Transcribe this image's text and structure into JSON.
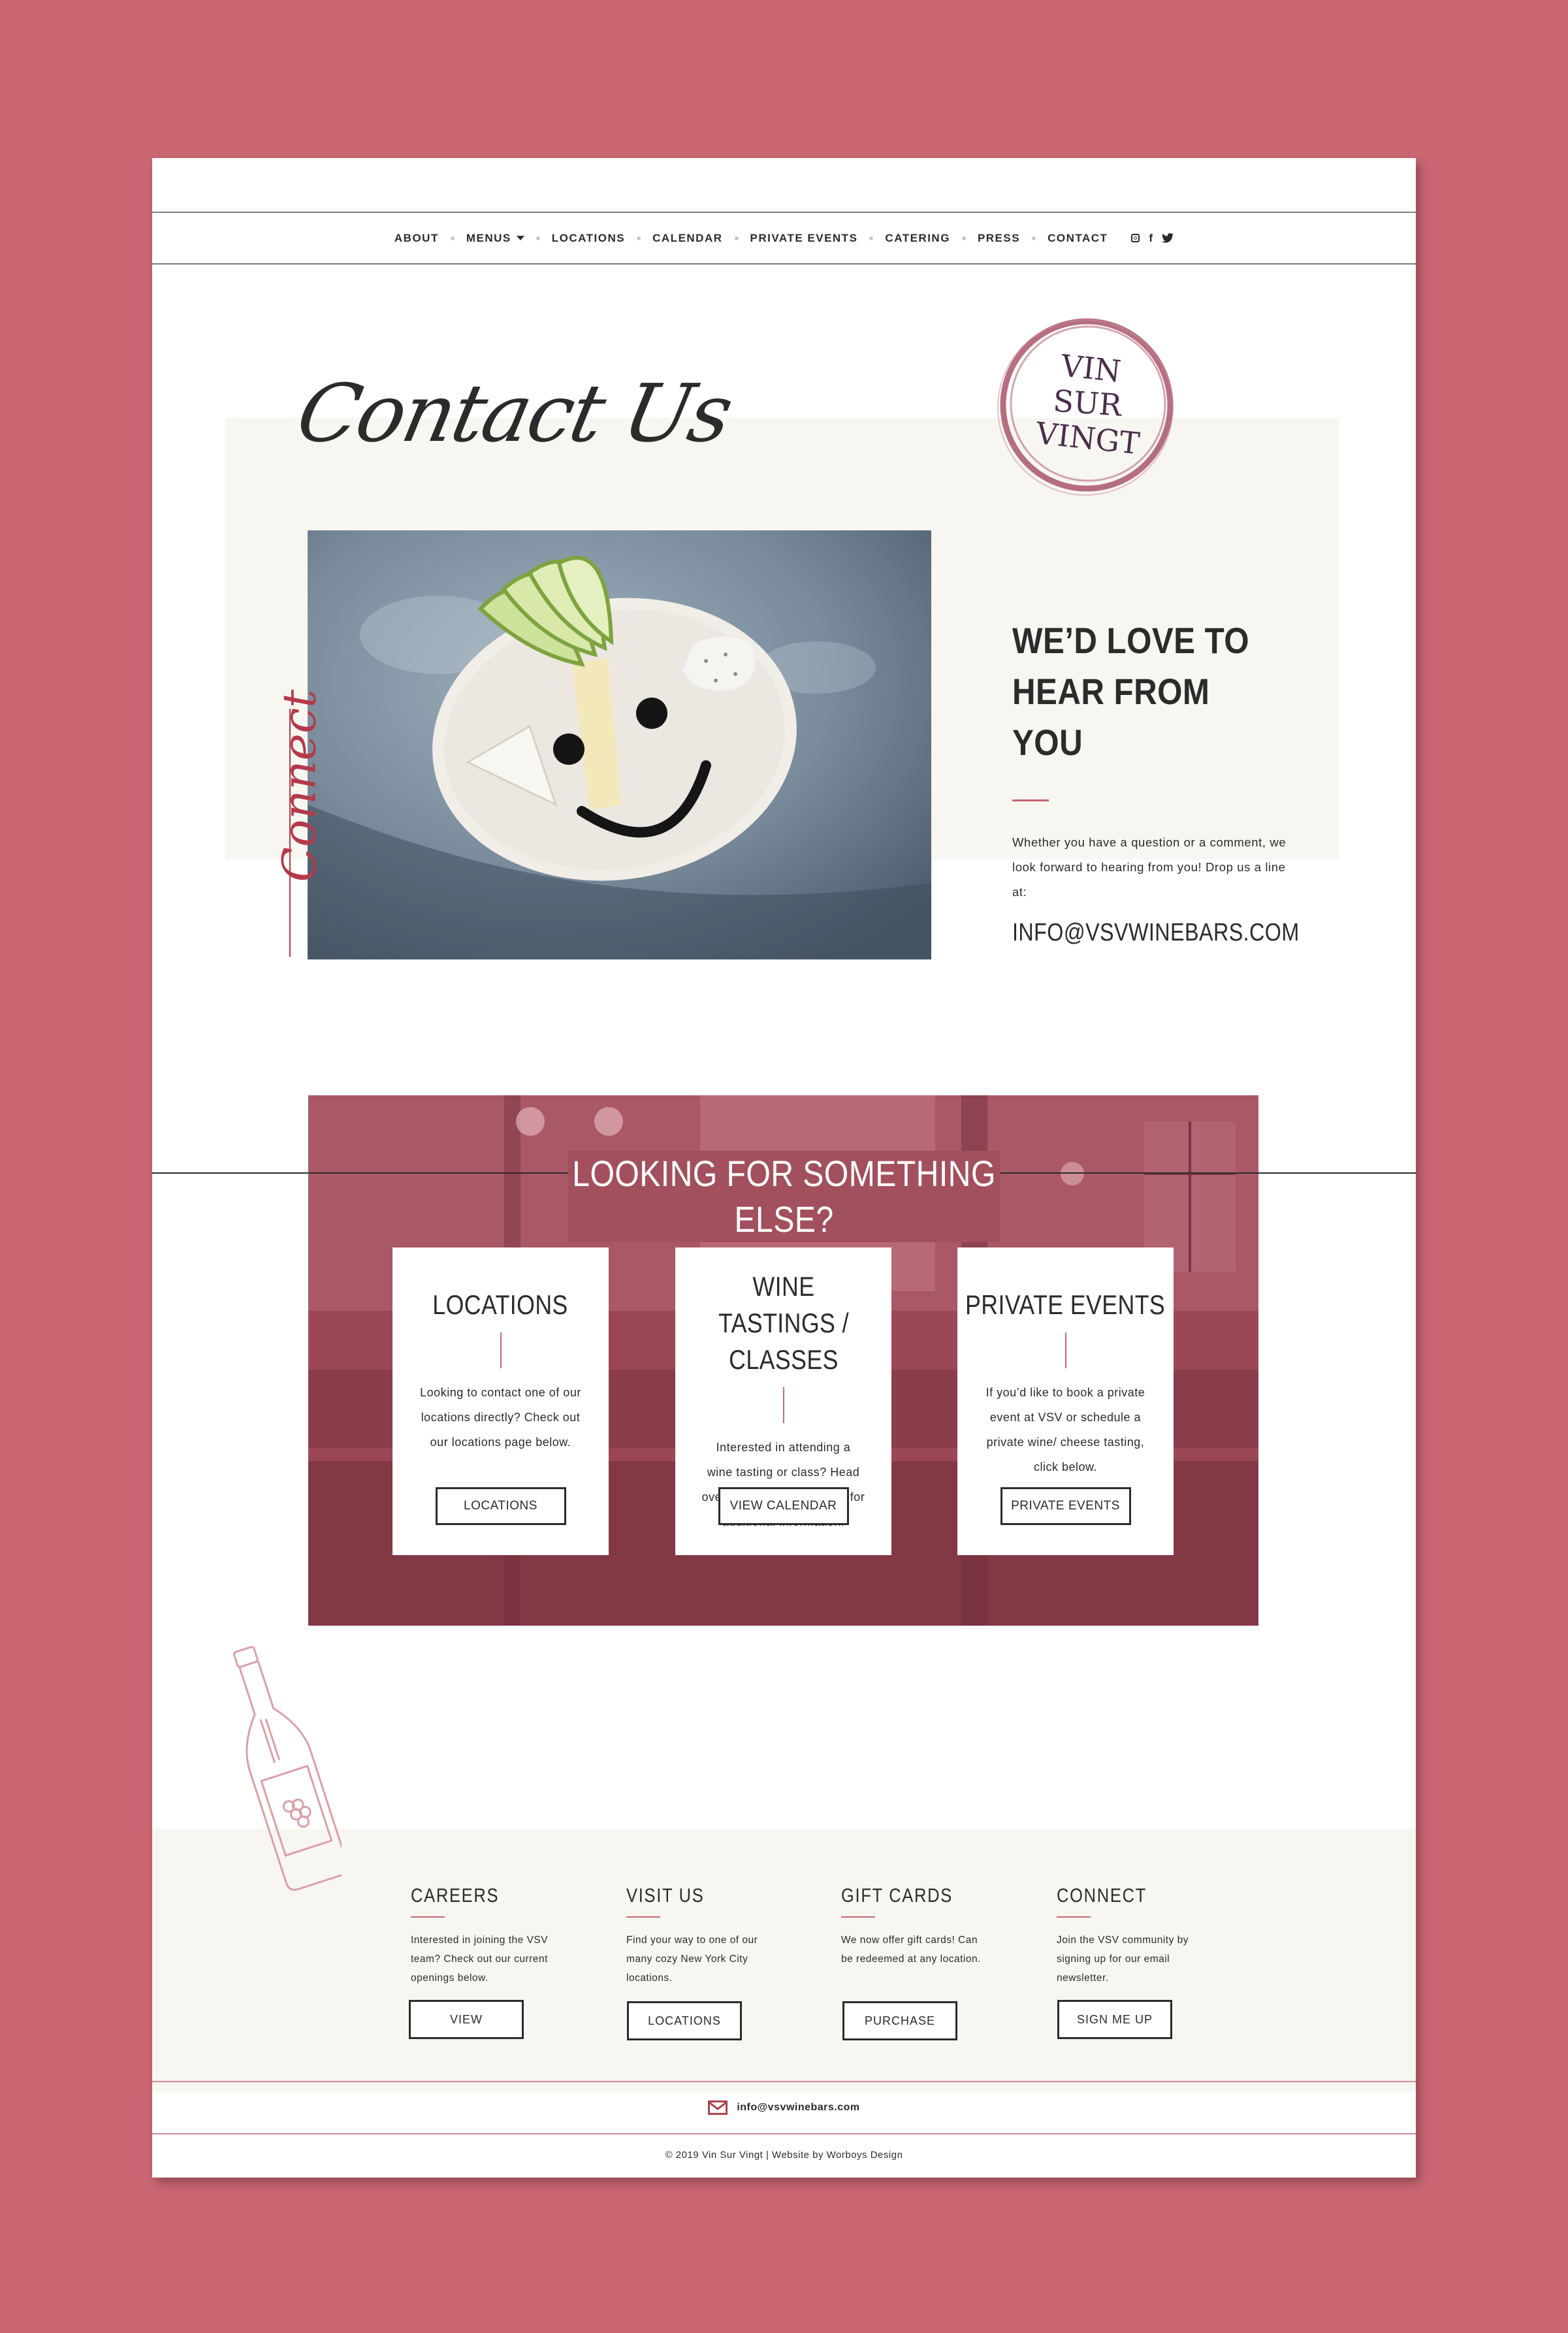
{
  "nav": {
    "items": [
      {
        "label": "ABOUT"
      },
      {
        "label": "MENUS",
        "has_dropdown": true
      },
      {
        "label": "LOCATIONS"
      },
      {
        "label": "CALENDAR"
      },
      {
        "label": "PRIVATE EVENTS"
      },
      {
        "label": "CATERING"
      },
      {
        "label": "PRESS"
      },
      {
        "label": "CONTACT"
      }
    ],
    "social_icons": [
      "instagram-icon",
      "facebook-icon",
      "twitter-icon"
    ],
    "social_glyphs": {
      "facebook": "f",
      "twitter": "🐦"
    }
  },
  "hero": {
    "script_title": "Contact Us",
    "side_script": "Connect",
    "logo_lines": [
      "VIN",
      "SUR",
      "VINGT"
    ],
    "heading": "WE’D LOVE TO HEAR FROM YOU",
    "body": "Whether you have a question or a comment, we look forward to hearing from you! Drop us a line at:",
    "email": "INFO@VSVWINEBARS.COM"
  },
  "else_section": {
    "title": "LOOKING FOR SOMETHING ELSE?",
    "cards": [
      {
        "title": "LOCATIONS",
        "body": "Looking to contact one of our locations directly? Check out our locations page below.",
        "button": "LOCATIONS"
      },
      {
        "title": "WINE TASTINGS / CLASSES",
        "body": "Interested in attending a wine tasting or class? Head over to our Calendar page for additional information.",
        "button": "VIEW CALENDAR"
      },
      {
        "title": "PRIVATE EVENTS",
        "body": "If you’d like to book a private event at VSV or schedule a private wine/ cheese tasting, click below.",
        "button": "PRIVATE EVENTS"
      }
    ]
  },
  "footer": {
    "columns": [
      {
        "title": "CAREERS",
        "body": "Interested in joining the VSV team? Check out our current openings below.",
        "button": "VIEW"
      },
      {
        "title": "VISIT US",
        "body": "Find your way to one of our many cozy New York City locations.",
        "button": "LOCATIONS"
      },
      {
        "title": "GIFT CARDS",
        "body": "We now offer gift cards! Can be redeemed at any location.",
        "button": "PURCHASE"
      },
      {
        "title": "CONNECT",
        "body": "Join the VSV community by signing up for our email newsletter.",
        "button": "SIGN ME UP"
      }
    ],
    "email": "info@vsvwinebars.com",
    "copyright": "© 2019 Vin Sur Vingt | Website by Worboys Design"
  },
  "colors": {
    "brand_pink": "#c96672",
    "wine": "#9b4655",
    "cream": "#f8f6f1",
    "text": "#2b2b2b"
  }
}
